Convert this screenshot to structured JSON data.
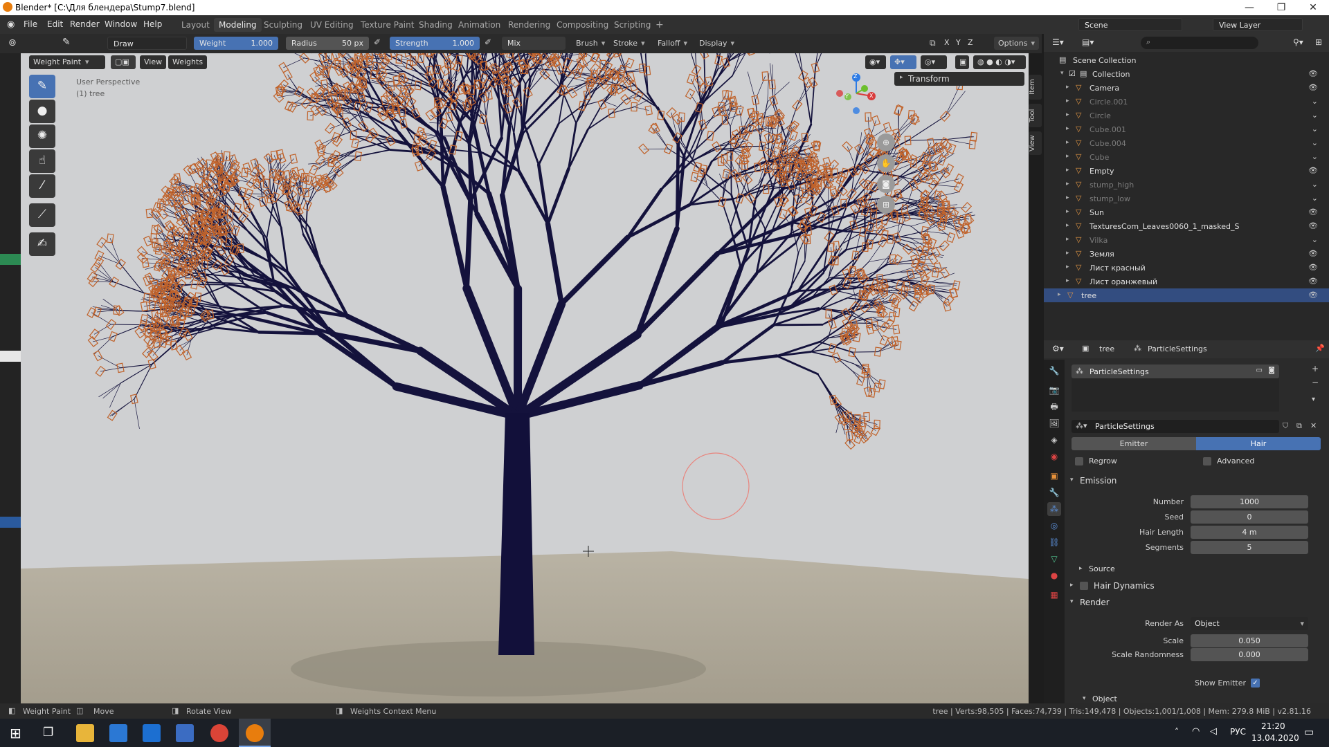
{
  "window": {
    "title": "Blender* [C:\\Для блендера\\Stump7.blend]",
    "controls": [
      "—",
      "❐",
      "✕"
    ]
  },
  "menu": {
    "items": [
      "File",
      "Edit",
      "Render",
      "Window",
      "Help"
    ]
  },
  "workspaces": {
    "tabs": [
      "Layout",
      "Modeling",
      "Sculpting",
      "UV Editing",
      "Texture Paint",
      "Shading",
      "Animation",
      "Rendering",
      "Compositing",
      "Scripting"
    ],
    "active": "Modeling",
    "add": "+"
  },
  "scene": {
    "name": "Scene",
    "view_layer": "View Layer"
  },
  "toolheader": {
    "brush_name": "Draw",
    "weight_label": "Weight",
    "weight_value": "1.000",
    "radius_label": "Radius",
    "radius_value": "50 px",
    "strength_label": "Strength",
    "strength_value": "1.000",
    "blend": "Mix",
    "brush": "Brush",
    "stroke": "Stroke",
    "falloff": "Falloff",
    "display": "Display",
    "axes": [
      "X",
      "Y",
      "Z"
    ],
    "options": "Options"
  },
  "viewport": {
    "mode": "Weight Paint",
    "view": "View",
    "weights": "Weights",
    "overlay_text": "User Perspective",
    "overlay_sub": "(1) tree",
    "transform_panel": "Transform",
    "side_tabs": [
      "Item",
      "Tool",
      "View"
    ],
    "gizmo_axes": [
      "Z",
      "Y",
      "X"
    ]
  },
  "outliner": {
    "root": "Scene Collection",
    "collection": "Collection",
    "items": [
      {
        "name": "Camera",
        "dim": false,
        "visible": true
      },
      {
        "name": "Circle.001",
        "dim": true,
        "visible": false
      },
      {
        "name": "Circle",
        "dim": true,
        "visible": false
      },
      {
        "name": "Cube.001",
        "dim": true,
        "visible": false
      },
      {
        "name": "Cube.004",
        "dim": true,
        "visible": false
      },
      {
        "name": "Cube",
        "dim": true,
        "visible": false
      },
      {
        "name": "Empty",
        "dim": false,
        "visible": true
      },
      {
        "name": "stump_high",
        "dim": true,
        "visible": false
      },
      {
        "name": "stump_low",
        "dim": true,
        "visible": false
      },
      {
        "name": "Sun",
        "dim": false,
        "visible": true
      },
      {
        "name": "TexturesCom_Leaves0060_1_masked_S",
        "dim": false,
        "visible": true
      },
      {
        "name": "Vilka",
        "dim": true,
        "visible": false
      },
      {
        "name": "Земля",
        "dim": false,
        "visible": true
      },
      {
        "name": "Лист красный",
        "dim": false,
        "visible": true
      },
      {
        "name": "Лист оранжевый",
        "dim": false,
        "visible": true
      },
      {
        "name": "tree",
        "dim": false,
        "visible": true,
        "selected": true
      }
    ]
  },
  "properties": {
    "object": "tree",
    "context": "ParticleSettings",
    "slot": "ParticleSettings",
    "settings_name": "ParticleSettings",
    "type_emitter": "Emitter",
    "type_hair": "Hair",
    "regrow": "Regrow",
    "advanced": "Advanced",
    "emission": "Emission",
    "number_label": "Number",
    "number_value": "1000",
    "seed_label": "Seed",
    "seed_value": "0",
    "hair_length_label": "Hair Length",
    "hair_length_value": "4 m",
    "segments_label": "Segments",
    "segments_value": "5",
    "source": "Source",
    "hair_dynamics": "Hair Dynamics",
    "render": "Render",
    "render_as_label": "Render As",
    "render_as_value": "Object",
    "scale_label": "Scale",
    "scale_value": "0.050",
    "scale_random_label": "Scale Randomness",
    "scale_random_value": "0.000",
    "show_emitter": "Show Emitter",
    "object_section": "Object"
  },
  "statusbar": {
    "mode": "Weight Paint",
    "move": "Move",
    "rotate": "Rotate View",
    "context_menu": "Weights Context Menu",
    "stats": "tree | Verts:98,505 | Faces:74,739 | Tris:149,478 | Objects:1,001/1,008 | Mem: 279.8 MiB | v2.81.16"
  },
  "taskbar": {
    "lang": "РУС",
    "time": "21:20",
    "date": "13.04.2020"
  }
}
